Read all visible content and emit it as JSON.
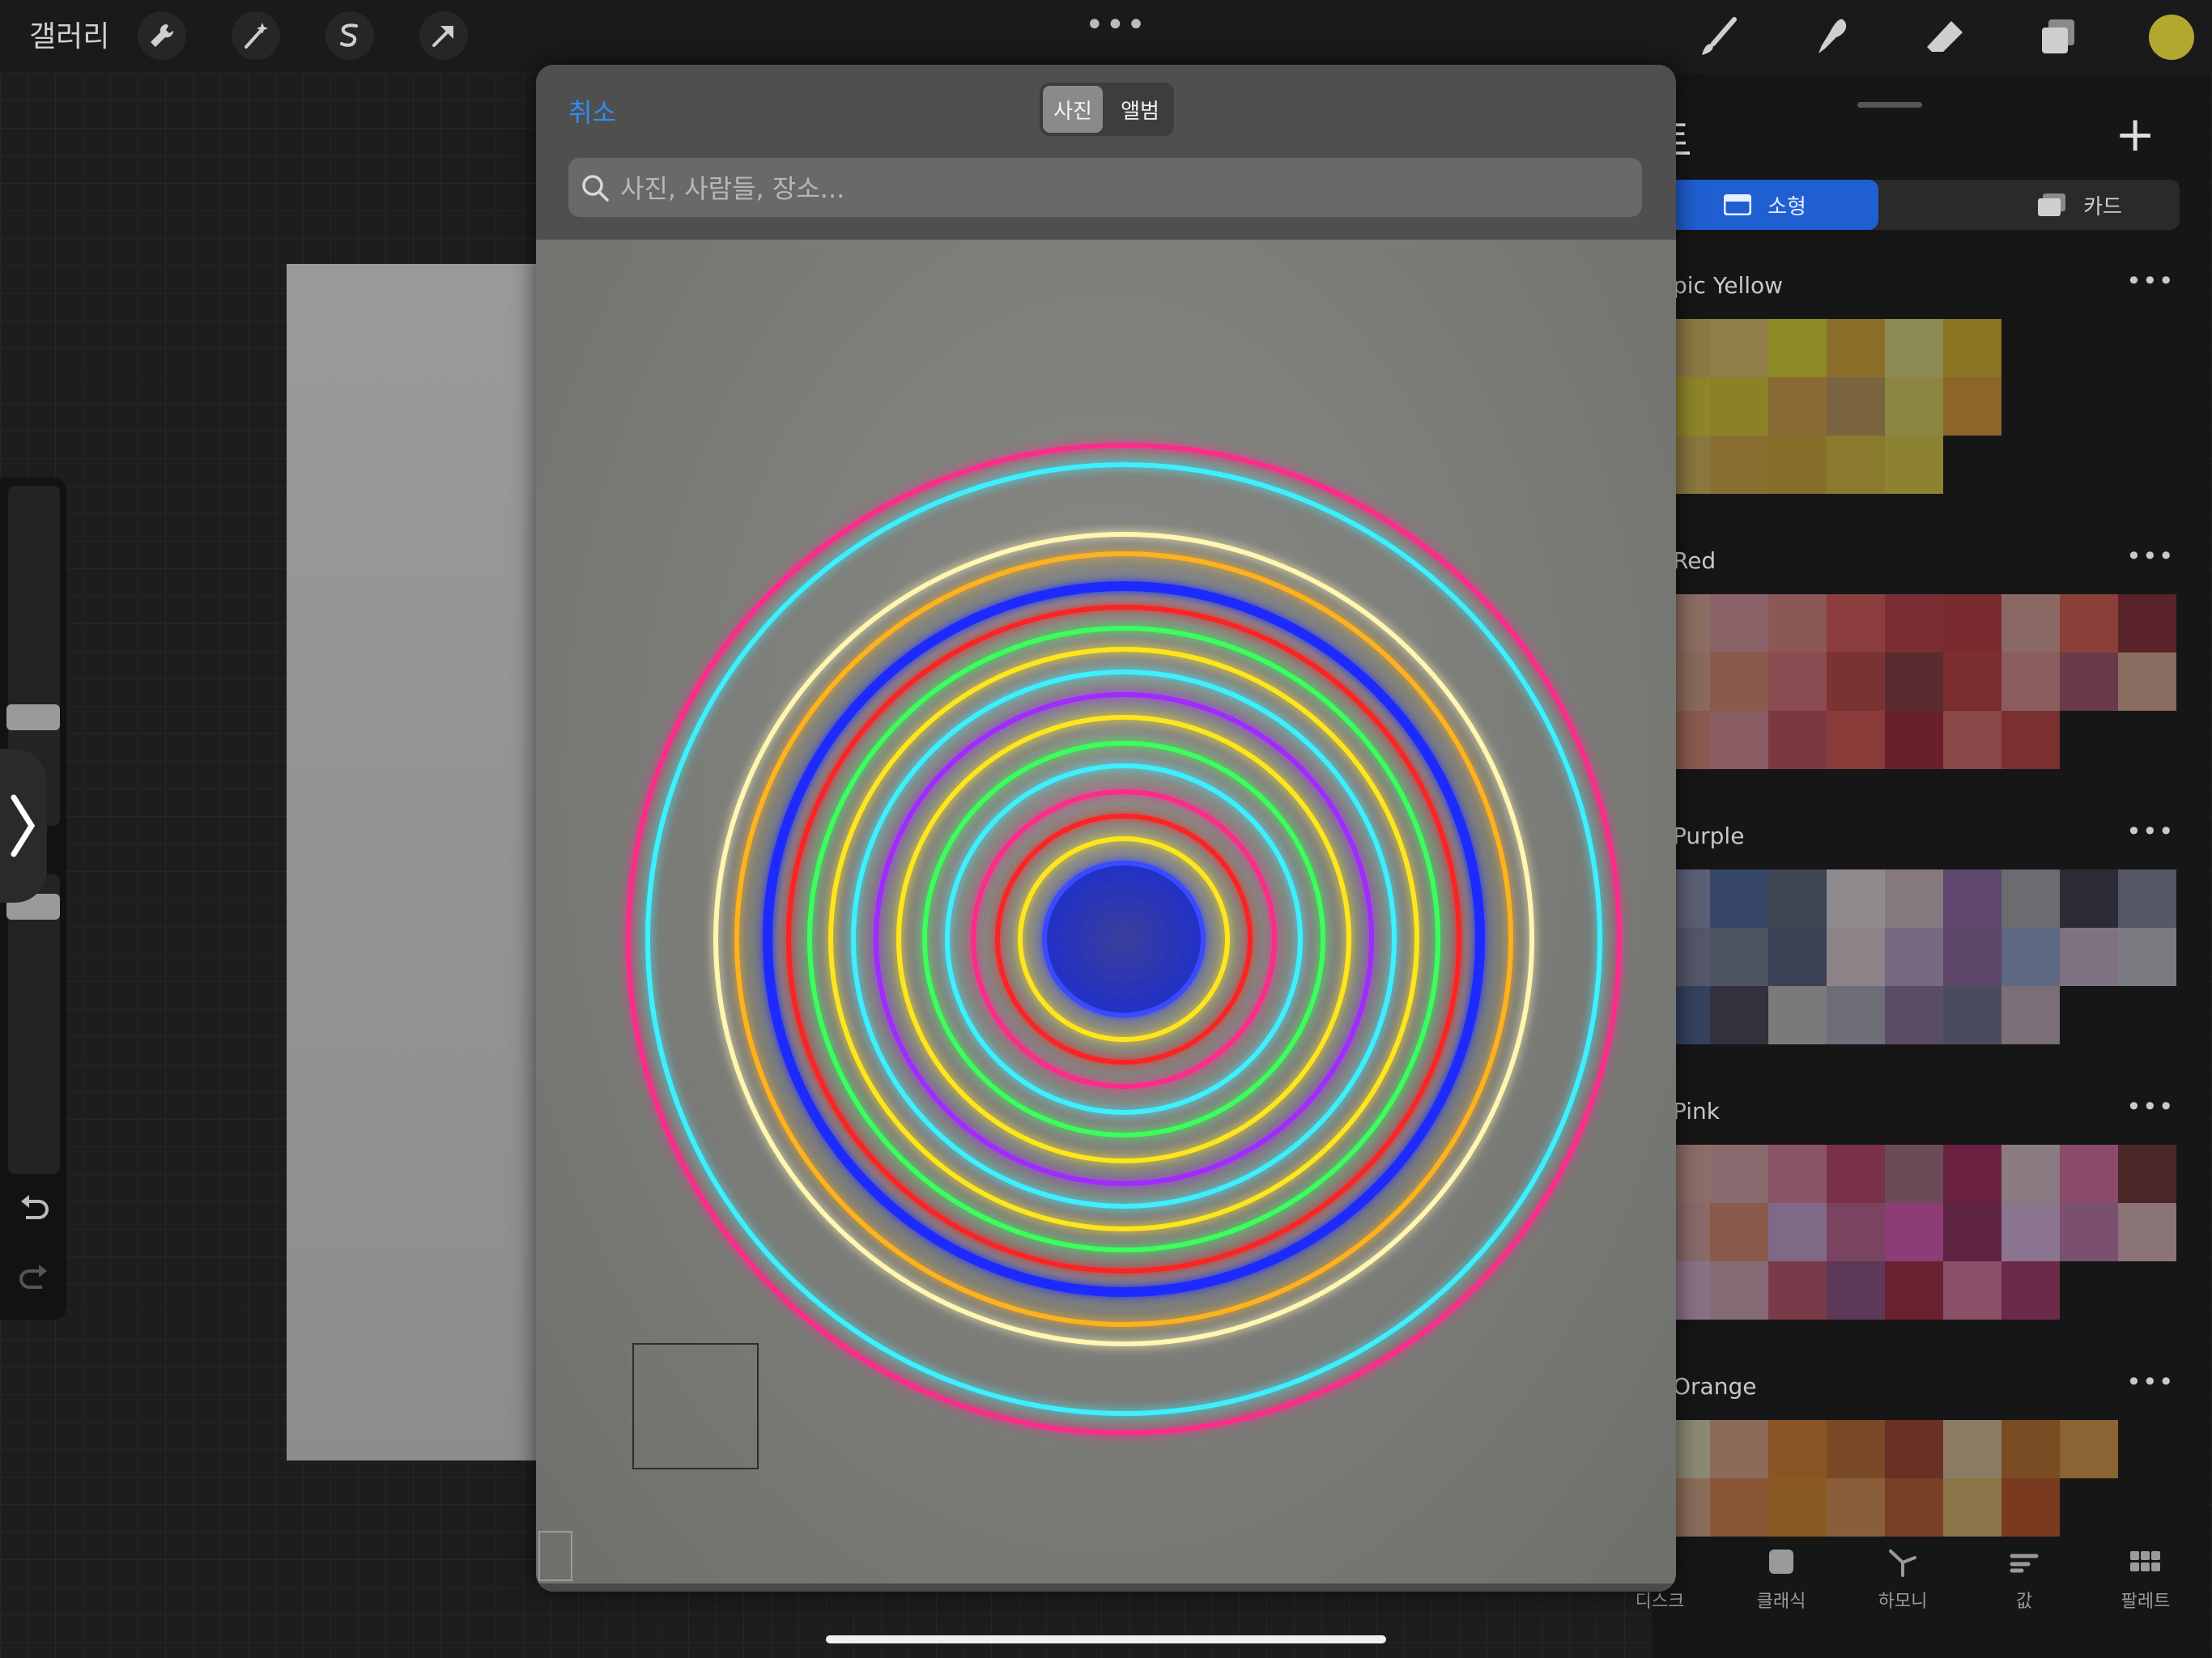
{
  "topbar": {
    "gallery_label": "갤러리",
    "more_label": "•••"
  },
  "picker": {
    "cancel_label": "취소",
    "tabs": [
      {
        "label": "사진",
        "selected": true
      },
      {
        "label": "앨범",
        "selected": false
      }
    ],
    "search_placeholder": "사진, 사람들, 장소..."
  },
  "palette_panel": {
    "title_visible": "트",
    "view_small_label": "소형",
    "view_card_label": "카드",
    "more_label": "•••",
    "palettes": [
      {
        "name": "pic Yellow",
        "colors": [
          "#8c7a45",
          "#8f7d4a",
          "#8e8a27",
          "#8a6e2a",
          "#8c8a54",
          "#8a7322",
          "#8e8628",
          "#8b8228",
          "#8a6a34",
          "#7a6440",
          "#8a853f",
          "#8c6628",
          "#8a7840",
          "#8a7030",
          "#876e2a",
          "#8a7a2e",
          "#8c8232"
        ]
      },
      {
        "name": "Red",
        "colors": [
          "#8c6e62",
          "#8a6268",
          "#8c5856",
          "#8c3e3e",
          "#7a2e33",
          "#7a2b30",
          "#8a6864",
          "#8a4038",
          "#5a2229",
          "#8a6a5c",
          "#8a5a4a",
          "#8a4c50",
          "#7a3232",
          "#5a2c30",
          "#7a2e2e",
          "#8a5c5c",
          "#6a3a48",
          "#8a6c60",
          "#8a5a50",
          "#8a5c64",
          "#7a3840",
          "#8a3c3a",
          "#6a2028",
          "#8a4848",
          "#7a3030"
        ]
      },
      {
        "name": "Purple",
        "colors": [
          "#5c6075",
          "#364666",
          "#3e4654",
          "#8e8a8e",
          "#85797f",
          "#5e466f",
          "#6b6b70",
          "#2c2c36",
          "#565766",
          "#55566a",
          "#4c5460",
          "#3c4156",
          "#8c8488",
          "#766a80",
          "#5c4668",
          "#5e6880",
          "#7e7282",
          "#7a7a80",
          "#34425c",
          "#34303e",
          "#7a7a7c",
          "#6e6e78",
          "#5a4c66",
          "#4a4c5e",
          "#7a6e78"
        ]
      },
      {
        "name": "Pink",
        "colors": [
          "#8c6e66",
          "#8a6a6e",
          "#8a5466",
          "#7a3048",
          "#6a4c58",
          "#6a2240",
          "#8a7a82",
          "#8a4c68",
          "#4a2828",
          "#8a6a6a",
          "#8a5a4a",
          "#7e6a86",
          "#7a4460",
          "#8e3c76",
          "#5e2440",
          "#8a7490",
          "#7a506e",
          "#8a7478",
          "#8a7286",
          "#866a76",
          "#7a3a4a",
          "#5e3858",
          "#6a2230",
          "#8a5068",
          "#6a2a48"
        ]
      },
      {
        "name": "Orange",
        "colors": [
          "#8c8a74",
          "#8c6a5a",
          "#8a5424",
          "#7a4a28",
          "#6a3026",
          "#8c7c66",
          "#7a4c24",
          "#8a6432",
          "#8a6c58",
          "#8a5638",
          "#8a5a24",
          "#8a5e3a",
          "#7a4026",
          "#8a7448",
          "#7a3a20"
        ]
      }
    ],
    "bottom_tabs": [
      "디스크",
      "클래식",
      "하모니",
      "값",
      "팔레트"
    ]
  }
}
